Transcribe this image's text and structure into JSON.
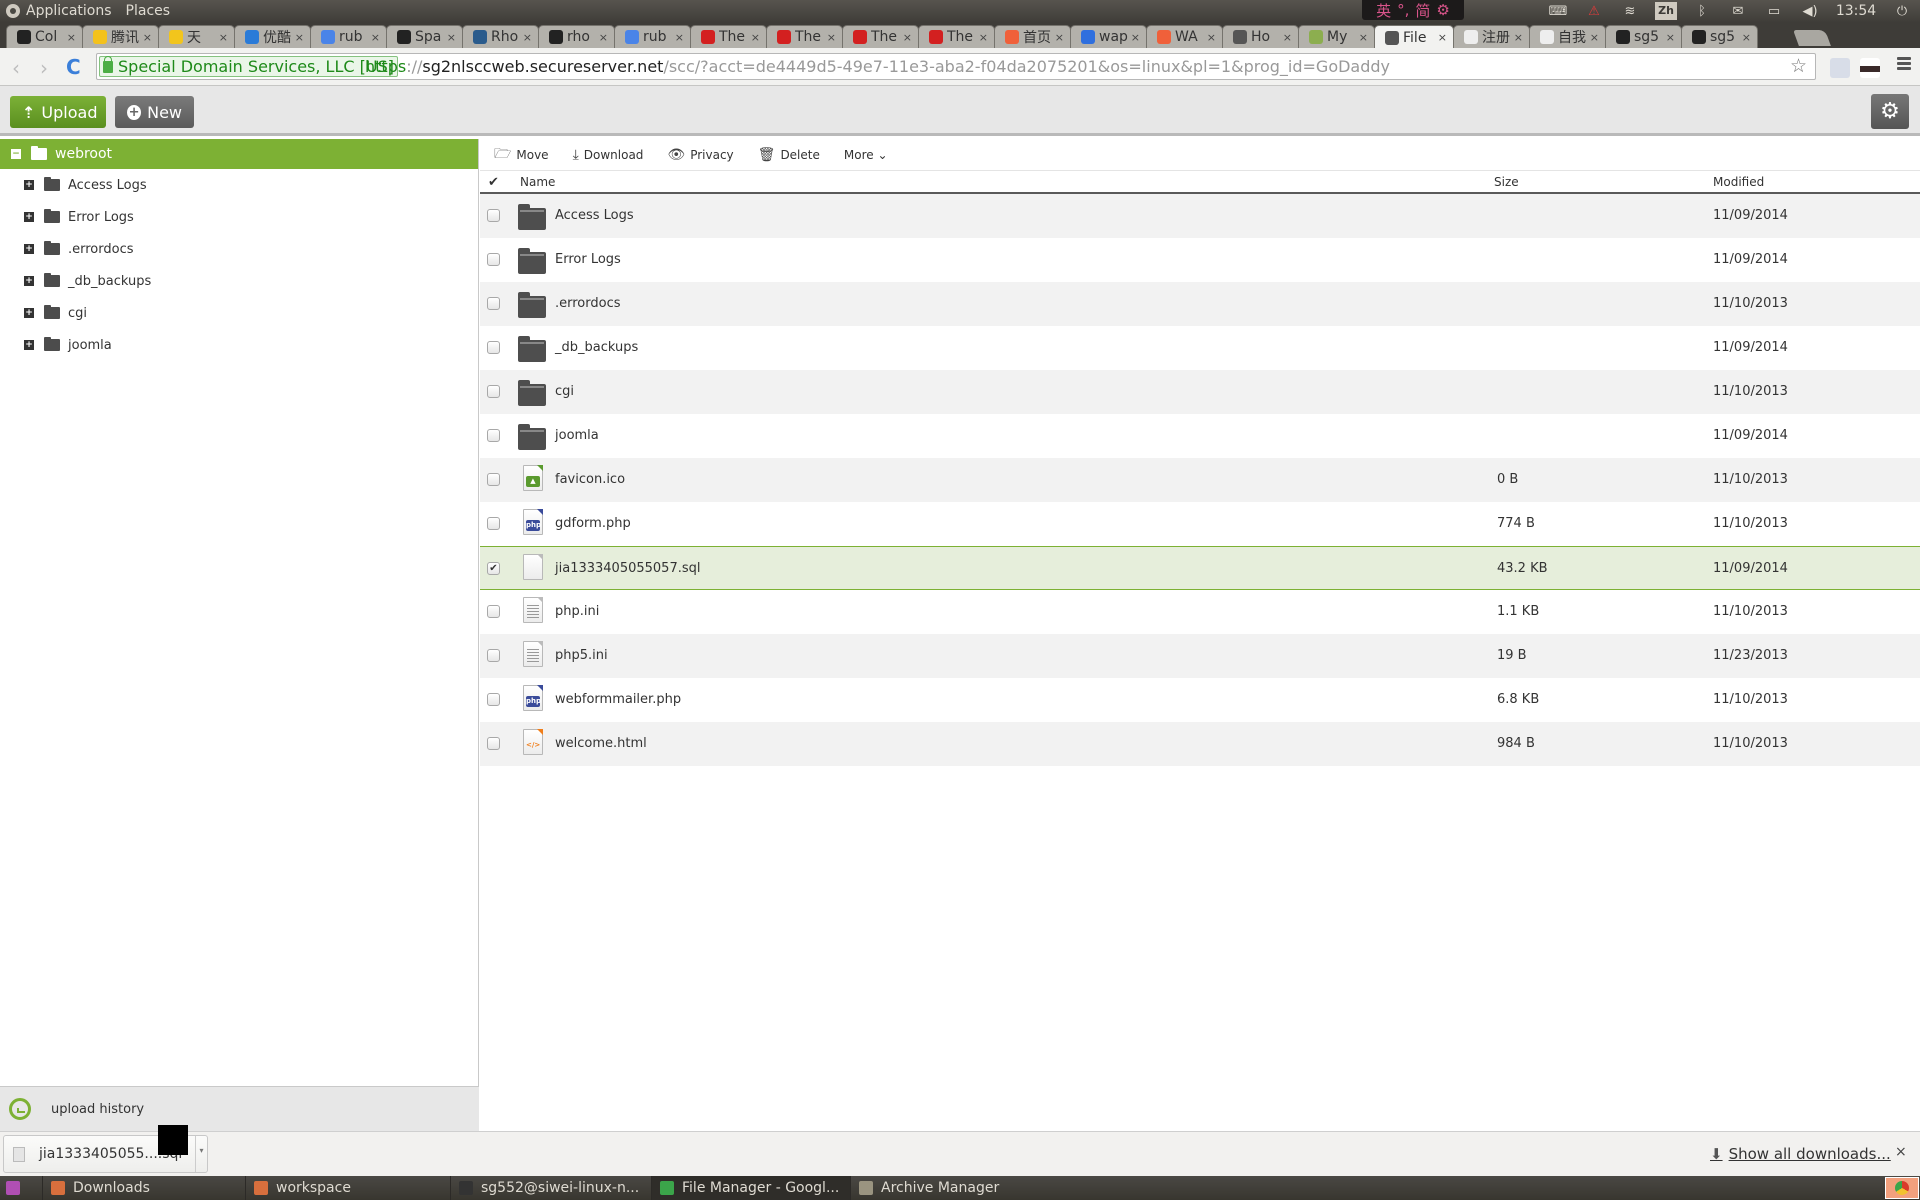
{
  "os_panel": {
    "menus": [
      "Applications",
      "Places"
    ],
    "ime": {
      "lang": "英",
      "punct": "°,",
      "mode": "简",
      "gear": "⚙"
    },
    "tray": {
      "keyboard": "⌨",
      "warning": "⚠",
      "wifi": "wifi",
      "lang": "Zh",
      "bluetooth": "ᛒ",
      "mail": "✉",
      "battery": "battery",
      "volume": "🔊",
      "clock": "13:54",
      "power": "⏻"
    }
  },
  "browser": {
    "tabs": [
      {
        "title": "Col",
        "icon": "github-icon",
        "color": "#222222"
      },
      {
        "title": "腾讯",
        "icon": "qq-icon",
        "color": "#f4c21c"
      },
      {
        "title": "天",
        "icon": "site-icon",
        "color": "#f2c51c"
      },
      {
        "title": "优酷",
        "icon": "youku-icon",
        "color": "#2a7bd8"
      },
      {
        "title": "rub",
        "icon": "google-icon",
        "color": "#4a84e8"
      },
      {
        "title": "Spa",
        "icon": "info-icon",
        "color": "#222222"
      },
      {
        "title": "Rho",
        "icon": "rhodecode-icon",
        "color": "#2a5b8c"
      },
      {
        "title": "rho",
        "icon": "github-icon",
        "color": "#222222"
      },
      {
        "title": "rub",
        "icon": "google-icon",
        "color": "#4a84e8"
      },
      {
        "title": "The",
        "icon": "gift-icon",
        "color": "#d32020"
      },
      {
        "title": "The",
        "icon": "gift-icon",
        "color": "#d32020"
      },
      {
        "title": "The",
        "icon": "gift-icon",
        "color": "#d32020"
      },
      {
        "title": "The",
        "icon": "gift-icon",
        "color": "#d32020"
      },
      {
        "title": "首页",
        "icon": "taobao-icon",
        "color": "#f0603a"
      },
      {
        "title": "wap",
        "icon": "baidu-icon",
        "color": "#2f6fde"
      },
      {
        "title": "WA",
        "icon": "taobao-icon",
        "color": "#f0603a"
      },
      {
        "title": "Ho",
        "icon": "server-icon",
        "color": "#555555"
      },
      {
        "title": "My",
        "icon": "plant-icon",
        "color": "#8cae4f"
      },
      {
        "title": "File",
        "icon": "server-icon",
        "color": "#555555",
        "active": true
      },
      {
        "title": "注册",
        "icon": "page-icon",
        "color": "#eeeeee"
      },
      {
        "title": "自我",
        "icon": "page-icon",
        "color": "#eeeeee"
      },
      {
        "title": "sg5",
        "icon": "github-icon",
        "color": "#222222"
      },
      {
        "title": "sg5",
        "icon": "github-icon",
        "color": "#222222"
      }
    ],
    "tab_close": "×",
    "window_controls": {
      "minimize": "–",
      "restore": "❐",
      "close": "✕"
    },
    "nav": {
      "back": "‹",
      "forward": "›",
      "reload": "C"
    },
    "ev_cert": "Special Domain Services, LLC [US]",
    "url": {
      "scheme": "https",
      "sep": "://",
      "host": "sg2nlsccweb.secureserver.net",
      "path": "/scc/?acct=de4449d5-49e7-11e3-aba2-f04da2075201&os=linux&pl=1&prog_id=GoDaddy"
    },
    "star": "☆"
  },
  "toolbar": {
    "upload_label": "Upload",
    "upload_icon": "⇡",
    "new_label": "New",
    "new_icon": "+",
    "settings_icon": "⚙"
  },
  "sidebar": {
    "root": {
      "label": "webroot",
      "toggle": "−"
    },
    "items": [
      {
        "label": "Access Logs",
        "toggle": "+"
      },
      {
        "label": "Error Logs",
        "toggle": "+"
      },
      {
        "label": ".errordocs",
        "toggle": "+"
      },
      {
        "label": "_db_backups",
        "toggle": "+"
      },
      {
        "label": "cgi",
        "toggle": "+"
      },
      {
        "label": "joomla",
        "toggle": "+"
      }
    ],
    "upload_history": "upload history"
  },
  "actions": [
    {
      "label": "Move",
      "icon": "🗁"
    },
    {
      "label": "Download",
      "icon": "⤓"
    },
    {
      "label": "Privacy",
      "icon": "👁"
    },
    {
      "label": "Delete",
      "icon": "🗑"
    },
    {
      "label": "More ⌄",
      "icon": ""
    }
  ],
  "list": {
    "columns": {
      "check": "✔",
      "name": "Name",
      "size": "Size",
      "modified": "Modified"
    },
    "rows": [
      {
        "name": "Access Logs",
        "type": "folder",
        "size": "",
        "modified": "11/09/2014",
        "checked": false
      },
      {
        "name": "Error Logs",
        "type": "folder",
        "size": "",
        "modified": "11/09/2014",
        "checked": false
      },
      {
        "name": ".errordocs",
        "type": "folder",
        "size": "",
        "modified": "11/10/2013",
        "checked": false
      },
      {
        "name": "_db_backups",
        "type": "folder",
        "size": "",
        "modified": "11/09/2014",
        "checked": false
      },
      {
        "name": "cgi",
        "type": "folder",
        "size": "",
        "modified": "11/10/2013",
        "checked": false
      },
      {
        "name": "joomla",
        "type": "folder",
        "size": "",
        "modified": "11/09/2014",
        "checked": false
      },
      {
        "name": "favicon.ico",
        "type": "image",
        "size": "0 B",
        "modified": "11/10/2013",
        "checked": false
      },
      {
        "name": "gdform.php",
        "type": "php",
        "size": "774 B",
        "modified": "11/10/2013",
        "checked": false
      },
      {
        "name": "jia1333405055057.sql",
        "type": "blank",
        "size": "43.2 KB",
        "modified": "11/09/2014",
        "checked": true
      },
      {
        "name": "php.ini",
        "type": "text",
        "size": "1.1 KB",
        "modified": "11/10/2013",
        "checked": false
      },
      {
        "name": "php5.ini",
        "type": "text",
        "size": "19 B",
        "modified": "11/23/2013",
        "checked": false
      },
      {
        "name": "webformmailer.php",
        "type": "php",
        "size": "6.8 KB",
        "modified": "11/10/2013",
        "checked": false
      },
      {
        "name": "welcome.html",
        "type": "html",
        "size": "984 B",
        "modified": "11/10/2013",
        "checked": false
      }
    ]
  },
  "downloads": {
    "item": "jia1333405055....sql",
    "dropdown": "▾",
    "show_all": "Show all downloads...",
    "show_all_icon": "⬇",
    "close": "×"
  },
  "taskbar": {
    "items": [
      {
        "label": "Downloads",
        "color": "#d86f3d"
      },
      {
        "label": "workspace",
        "color": "#d86f3d"
      },
      {
        "label": "sg552@siwei-linux-n...",
        "color": "#333333"
      },
      {
        "label": "File Manager - Googl...",
        "color": "#3ba54a",
        "active": true
      },
      {
        "label": "Archive Manager",
        "color": "#9a9480"
      }
    ]
  },
  "colors": {
    "accent": "#7db134",
    "selected_row": "#e6eedb",
    "php": "#3a4b9a",
    "html": "#f07e1b",
    "image": "#5a9a2e"
  }
}
